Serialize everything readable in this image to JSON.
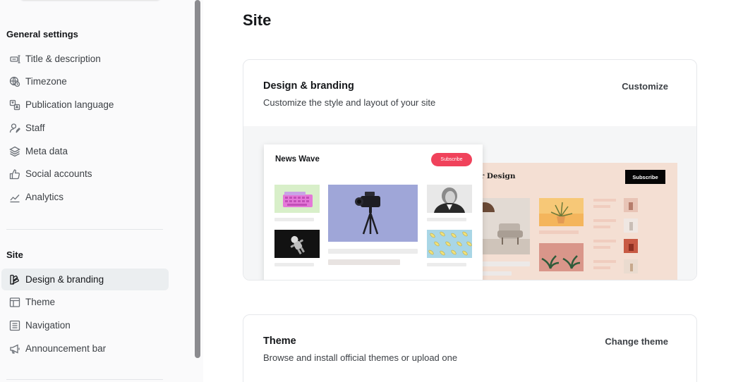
{
  "sidebar": {
    "groups": [
      {
        "title": "General settings",
        "items": [
          {
            "label": "Title & description",
            "icon": "title-icon"
          },
          {
            "label": "Timezone",
            "icon": "globe-clock-icon"
          },
          {
            "label": "Publication language",
            "icon": "translate-icon"
          },
          {
            "label": "Staff",
            "icon": "staff-icon"
          },
          {
            "label": "Meta data",
            "icon": "layers-icon"
          },
          {
            "label": "Social accounts",
            "icon": "thumbs-up-icon"
          },
          {
            "label": "Analytics",
            "icon": "analytics-icon"
          }
        ]
      },
      {
        "title": "Site",
        "items": [
          {
            "label": "Design & branding",
            "icon": "design-icon",
            "active": true
          },
          {
            "label": "Theme",
            "icon": "theme-icon"
          },
          {
            "label": "Navigation",
            "icon": "navigation-icon"
          },
          {
            "label": "Announcement bar",
            "icon": "megaphone-icon"
          }
        ]
      }
    ]
  },
  "main": {
    "title": "Site",
    "design_card": {
      "title": "Design & branding",
      "description": "Customize the style and layout of your site",
      "action": "Customize",
      "preview": {
        "front_site_title": "News Wave",
        "front_subscribe": "Subscribe",
        "back_site_title": "nterior Design",
        "back_subscribe": "Subscribe"
      }
    },
    "theme_card": {
      "title": "Theme",
      "description": "Browse and install official themes or upload one",
      "action": "Change theme"
    }
  },
  "colors": {
    "accent_subscribe": "#f0425b",
    "active_nav_bg": "#ebeef0",
    "interior_bg": "#f4dfd3"
  }
}
